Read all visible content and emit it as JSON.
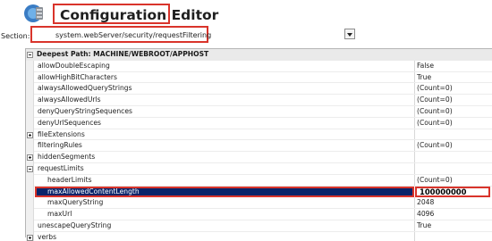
{
  "window": {
    "title": "Configuration Editor",
    "icon": "server-config-icon"
  },
  "section": {
    "label": "Section:",
    "value": "system.webServer/security/requestFiltering"
  },
  "grid": {
    "header": "Deepest Path: MACHINE/WEBROOT/APPHOST",
    "rows": [
      {
        "name": "allowDoubleEscaping",
        "value": "False"
      },
      {
        "name": "allowHighBitCharacters",
        "value": "True"
      },
      {
        "name": "alwaysAllowedQueryStrings",
        "value": "(Count=0)"
      },
      {
        "name": "alwaysAllowedUrls",
        "value": "(Count=0)"
      },
      {
        "name": "denyQueryStringSequences",
        "value": "(Count=0)"
      },
      {
        "name": "denyUrlSequences",
        "value": "(Count=0)"
      },
      {
        "name": "fileExtensions",
        "value": ""
      },
      {
        "name": "filteringRules",
        "value": "(Count=0)"
      },
      {
        "name": "hiddenSegments",
        "value": ""
      },
      {
        "name": "requestLimits",
        "value": ""
      },
      {
        "name": "headerLimits",
        "value": "(Count=0)"
      },
      {
        "name": "maxAllowedContentLength",
        "value": "100000000"
      },
      {
        "name": "maxQueryString",
        "value": "2048"
      },
      {
        "name": "maxUrl",
        "value": "4096"
      },
      {
        "name": "unescapeQueryString",
        "value": "True"
      },
      {
        "name": "verbs",
        "value": ""
      }
    ]
  },
  "colors": {
    "highlight_border": "#d9342b",
    "selection": "#0a246a"
  }
}
